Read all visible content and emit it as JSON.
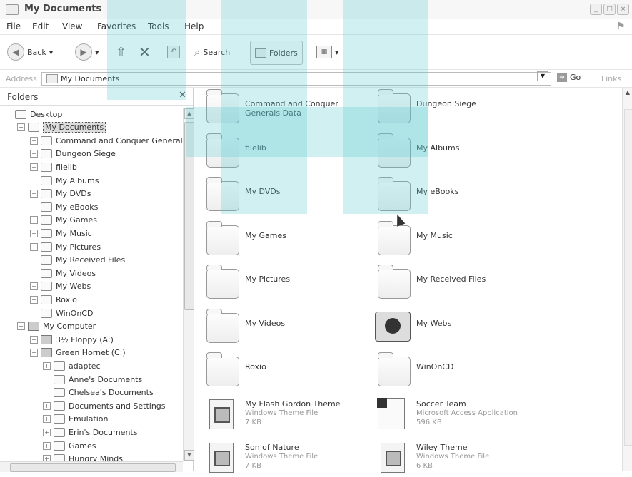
{
  "window": {
    "title": "My Documents",
    "buttons": [
      "_",
      "□",
      "×"
    ]
  },
  "menu": [
    "File",
    "Edit",
    "View",
    "Favorites",
    "Tools",
    "Help"
  ],
  "toolbar": {
    "back": "Back",
    "search": "Search",
    "folders": "Folders"
  },
  "address": {
    "label": "Address",
    "value": "My Documents",
    "go": "Go",
    "links": "Links"
  },
  "folders_pane": {
    "title": "Folders",
    "tree": [
      {
        "label": "Desktop",
        "level": 0,
        "exp": ""
      },
      {
        "label": "My Documents",
        "level": 1,
        "exp": "−",
        "selected": true
      },
      {
        "label": "Command and Conquer Generals",
        "level": 2,
        "exp": "+"
      },
      {
        "label": "Dungeon Siege",
        "level": 2,
        "exp": "+"
      },
      {
        "label": "filelib",
        "level": 2,
        "exp": "+"
      },
      {
        "label": "My Albums",
        "level": 2,
        "exp": ""
      },
      {
        "label": "My DVDs",
        "level": 2,
        "exp": "+"
      },
      {
        "label": "My eBooks",
        "level": 2,
        "exp": ""
      },
      {
        "label": "My Games",
        "level": 2,
        "exp": "+"
      },
      {
        "label": "My Music",
        "level": 2,
        "exp": "+"
      },
      {
        "label": "My Pictures",
        "level": 2,
        "exp": "+"
      },
      {
        "label": "My Received Files",
        "level": 2,
        "exp": ""
      },
      {
        "label": "My Videos",
        "level": 2,
        "exp": ""
      },
      {
        "label": "My Webs",
        "level": 2,
        "exp": "+"
      },
      {
        "label": "Roxio",
        "level": 2,
        "exp": "+"
      },
      {
        "label": "WinOnCD",
        "level": 2,
        "exp": ""
      },
      {
        "label": "My Computer",
        "level": 1,
        "exp": "−"
      },
      {
        "label": "3½ Floppy (A:)",
        "level": 2,
        "exp": "+"
      },
      {
        "label": "Green Hornet (C:)",
        "level": 2,
        "exp": "−"
      },
      {
        "label": "adaptec",
        "level": 3,
        "exp": "+"
      },
      {
        "label": "Anne's Documents",
        "level": 3,
        "exp": ""
      },
      {
        "label": "Chelsea's Documents",
        "level": 3,
        "exp": ""
      },
      {
        "label": "Documents and Settings",
        "level": 3,
        "exp": "+"
      },
      {
        "label": "Emulation",
        "level": 3,
        "exp": "+"
      },
      {
        "label": "Erin's Documents",
        "level": 3,
        "exp": "+"
      },
      {
        "label": "Games",
        "level": 3,
        "exp": "+"
      },
      {
        "label": "Hungry Minds",
        "level": 3,
        "exp": "+"
      }
    ]
  },
  "items": [
    {
      "name": "Command and Conquer Generals Data",
      "type": "folder"
    },
    {
      "name": "Dungeon Siege",
      "type": "folder"
    },
    {
      "name": "filelib",
      "type": "folder"
    },
    {
      "name": "My Albums",
      "type": "folder"
    },
    {
      "name": "My DVDs",
      "type": "folder"
    },
    {
      "name": "My eBooks",
      "type": "folder"
    },
    {
      "name": "My Games",
      "type": "folder"
    },
    {
      "name": "My Music",
      "type": "folder"
    },
    {
      "name": "My Pictures",
      "type": "folder"
    },
    {
      "name": "My Received Files",
      "type": "folder"
    },
    {
      "name": "My Videos",
      "type": "folder"
    },
    {
      "name": "My Webs",
      "type": "web"
    },
    {
      "name": "Roxio",
      "type": "folder"
    },
    {
      "name": "WinOnCD",
      "type": "folder"
    },
    {
      "name": "My Flash Gordon Theme",
      "type": "theme",
      "subtype": "Windows Theme File",
      "size": "7 KB"
    },
    {
      "name": "Soccer Team",
      "type": "access",
      "subtype": "Microsoft Access Application",
      "size": "596 KB"
    },
    {
      "name": "Son of Nature",
      "type": "theme",
      "subtype": "Windows Theme File",
      "size": "7 KB"
    },
    {
      "name": "Wiley Theme",
      "type": "theme",
      "subtype": "Windows Theme File",
      "size": "6 KB"
    }
  ]
}
